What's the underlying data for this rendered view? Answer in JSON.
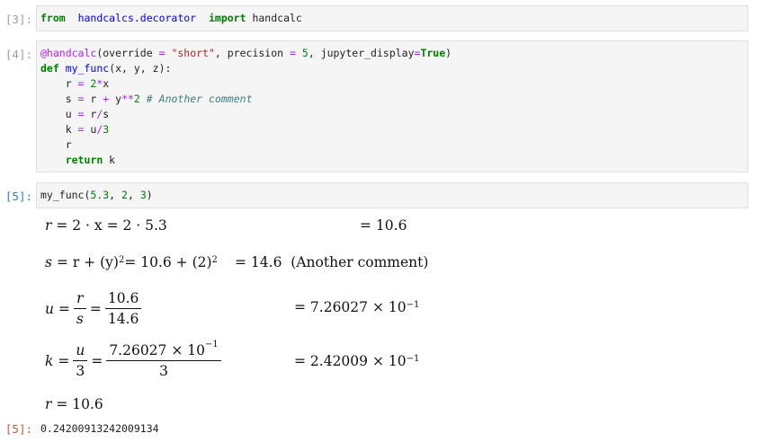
{
  "cells": [
    {
      "prompt": "[3]:",
      "code": [
        [
          [
            "kw",
            "from"
          ],
          [
            "",
            "  "
          ],
          [
            "mod",
            "handcalcs.decorator"
          ],
          [
            "",
            "  "
          ],
          [
            "kw",
            "import"
          ],
          [
            "",
            " handcalc"
          ]
        ]
      ]
    },
    {
      "prompt": "[4]:",
      "code": [
        [
          [
            "deco",
            "@handcalc"
          ],
          [
            "",
            "(override "
          ],
          [
            "op",
            "="
          ],
          [
            "",
            " "
          ],
          [
            "str",
            "\"short\""
          ],
          [
            "",
            ", precision "
          ],
          [
            "op",
            "="
          ],
          [
            "",
            " "
          ],
          [
            "num",
            "5"
          ],
          [
            "",
            ", jupyter_display"
          ],
          [
            "op",
            "="
          ],
          [
            "kw",
            "True"
          ],
          [
            "",
            ")"
          ]
        ],
        [
          [
            "kw",
            "def"
          ],
          [
            "",
            " "
          ],
          [
            "func",
            "my_func"
          ],
          [
            "",
            "(x, y, z):"
          ]
        ],
        [
          [
            "",
            "    r "
          ],
          [
            "op",
            "="
          ],
          [
            "",
            " "
          ],
          [
            "num",
            "2"
          ],
          [
            "op",
            "*"
          ],
          [
            "",
            "x"
          ]
        ],
        [
          [
            "",
            "    s "
          ],
          [
            "op",
            "="
          ],
          [
            "",
            " r "
          ],
          [
            "op",
            "+"
          ],
          [
            "",
            " y"
          ],
          [
            "op",
            "**"
          ],
          [
            "num",
            "2"
          ],
          [
            "",
            " "
          ],
          [
            "com",
            "# Another comment"
          ]
        ],
        [
          [
            "",
            "    u "
          ],
          [
            "op",
            "="
          ],
          [
            "",
            " r"
          ],
          [
            "op",
            "/"
          ],
          [
            "",
            "s"
          ]
        ],
        [
          [
            "",
            "    k "
          ],
          [
            "op",
            "="
          ],
          [
            "",
            " u"
          ],
          [
            "op",
            "/"
          ],
          [
            "num",
            "3"
          ]
        ],
        [
          [
            "",
            "    r"
          ]
        ],
        [
          [
            "",
            "    "
          ],
          [
            "kw",
            "return"
          ],
          [
            "",
            " k"
          ]
        ]
      ]
    },
    {
      "prompt": "[5]:",
      "code": [
        [
          [
            "",
            "my_func("
          ],
          [
            "num",
            "5.3"
          ],
          [
            "",
            ", "
          ],
          [
            "num",
            "2"
          ],
          [
            "",
            ", "
          ],
          [
            "num",
            "3"
          ],
          [
            "",
            ")"
          ]
        ]
      ]
    }
  ],
  "math": {
    "r_line": {
      "lhs": "r",
      "mid": "= 2 · x = 2 · 5.3",
      "res": "= 10.6"
    },
    "s_line": {
      "lhs": "s",
      "mid_a": "= r + (y)",
      "mid_b": " = 10.6 + (2)",
      "exp": "2",
      "res": "= 14.6",
      "comment": "(Another comment)"
    },
    "u_line": {
      "lhs": "u",
      "n1": "r",
      "d1": "s",
      "n2": "10.6",
      "d2": "14.6",
      "res_a": "= 7.26027 × 10",
      "res_exp": "−1"
    },
    "k_line": {
      "lhs": "k",
      "n1": "u",
      "d1": "3",
      "n2a": "7.26027 × 10",
      "n2exp": "−1",
      "d2": "3",
      "res_a": "= 2.42009 × 10",
      "res_exp": "−1"
    },
    "r_final": "r = 10.6"
  },
  "output": {
    "prompt": "[5]:",
    "value": "0.24200913242009134"
  }
}
